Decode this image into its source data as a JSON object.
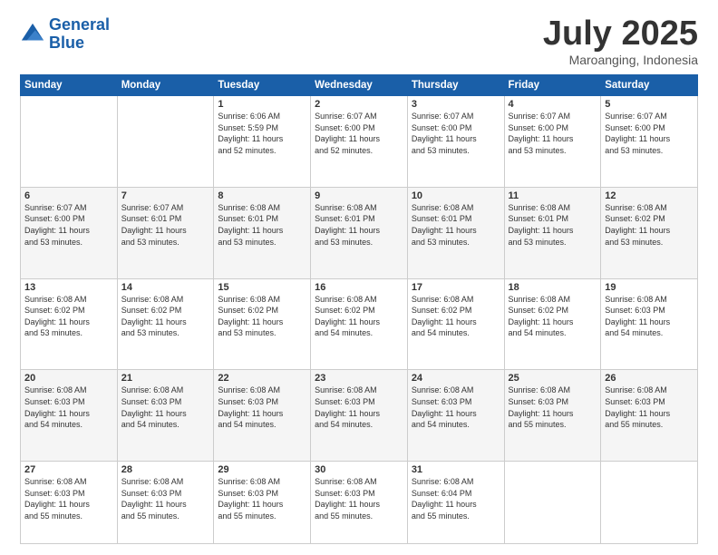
{
  "header": {
    "logo_line1": "General",
    "logo_line2": "Blue",
    "month": "July 2025",
    "location": "Maroanging, Indonesia"
  },
  "weekdays": [
    "Sunday",
    "Monday",
    "Tuesday",
    "Wednesday",
    "Thursday",
    "Friday",
    "Saturday"
  ],
  "weeks": [
    [
      {
        "day": "",
        "info": ""
      },
      {
        "day": "",
        "info": ""
      },
      {
        "day": "1",
        "info": "Sunrise: 6:06 AM\nSunset: 5:59 PM\nDaylight: 11 hours\nand 52 minutes."
      },
      {
        "day": "2",
        "info": "Sunrise: 6:07 AM\nSunset: 6:00 PM\nDaylight: 11 hours\nand 52 minutes."
      },
      {
        "day": "3",
        "info": "Sunrise: 6:07 AM\nSunset: 6:00 PM\nDaylight: 11 hours\nand 53 minutes."
      },
      {
        "day": "4",
        "info": "Sunrise: 6:07 AM\nSunset: 6:00 PM\nDaylight: 11 hours\nand 53 minutes."
      },
      {
        "day": "5",
        "info": "Sunrise: 6:07 AM\nSunset: 6:00 PM\nDaylight: 11 hours\nand 53 minutes."
      }
    ],
    [
      {
        "day": "6",
        "info": "Sunrise: 6:07 AM\nSunset: 6:00 PM\nDaylight: 11 hours\nand 53 minutes."
      },
      {
        "day": "7",
        "info": "Sunrise: 6:07 AM\nSunset: 6:01 PM\nDaylight: 11 hours\nand 53 minutes."
      },
      {
        "day": "8",
        "info": "Sunrise: 6:08 AM\nSunset: 6:01 PM\nDaylight: 11 hours\nand 53 minutes."
      },
      {
        "day": "9",
        "info": "Sunrise: 6:08 AM\nSunset: 6:01 PM\nDaylight: 11 hours\nand 53 minutes."
      },
      {
        "day": "10",
        "info": "Sunrise: 6:08 AM\nSunset: 6:01 PM\nDaylight: 11 hours\nand 53 minutes."
      },
      {
        "day": "11",
        "info": "Sunrise: 6:08 AM\nSunset: 6:01 PM\nDaylight: 11 hours\nand 53 minutes."
      },
      {
        "day": "12",
        "info": "Sunrise: 6:08 AM\nSunset: 6:02 PM\nDaylight: 11 hours\nand 53 minutes."
      }
    ],
    [
      {
        "day": "13",
        "info": "Sunrise: 6:08 AM\nSunset: 6:02 PM\nDaylight: 11 hours\nand 53 minutes."
      },
      {
        "day": "14",
        "info": "Sunrise: 6:08 AM\nSunset: 6:02 PM\nDaylight: 11 hours\nand 53 minutes."
      },
      {
        "day": "15",
        "info": "Sunrise: 6:08 AM\nSunset: 6:02 PM\nDaylight: 11 hours\nand 53 minutes."
      },
      {
        "day": "16",
        "info": "Sunrise: 6:08 AM\nSunset: 6:02 PM\nDaylight: 11 hours\nand 54 minutes."
      },
      {
        "day": "17",
        "info": "Sunrise: 6:08 AM\nSunset: 6:02 PM\nDaylight: 11 hours\nand 54 minutes."
      },
      {
        "day": "18",
        "info": "Sunrise: 6:08 AM\nSunset: 6:02 PM\nDaylight: 11 hours\nand 54 minutes."
      },
      {
        "day": "19",
        "info": "Sunrise: 6:08 AM\nSunset: 6:03 PM\nDaylight: 11 hours\nand 54 minutes."
      }
    ],
    [
      {
        "day": "20",
        "info": "Sunrise: 6:08 AM\nSunset: 6:03 PM\nDaylight: 11 hours\nand 54 minutes."
      },
      {
        "day": "21",
        "info": "Sunrise: 6:08 AM\nSunset: 6:03 PM\nDaylight: 11 hours\nand 54 minutes."
      },
      {
        "day": "22",
        "info": "Sunrise: 6:08 AM\nSunset: 6:03 PM\nDaylight: 11 hours\nand 54 minutes."
      },
      {
        "day": "23",
        "info": "Sunrise: 6:08 AM\nSunset: 6:03 PM\nDaylight: 11 hours\nand 54 minutes."
      },
      {
        "day": "24",
        "info": "Sunrise: 6:08 AM\nSunset: 6:03 PM\nDaylight: 11 hours\nand 54 minutes."
      },
      {
        "day": "25",
        "info": "Sunrise: 6:08 AM\nSunset: 6:03 PM\nDaylight: 11 hours\nand 55 minutes."
      },
      {
        "day": "26",
        "info": "Sunrise: 6:08 AM\nSunset: 6:03 PM\nDaylight: 11 hours\nand 55 minutes."
      }
    ],
    [
      {
        "day": "27",
        "info": "Sunrise: 6:08 AM\nSunset: 6:03 PM\nDaylight: 11 hours\nand 55 minutes."
      },
      {
        "day": "28",
        "info": "Sunrise: 6:08 AM\nSunset: 6:03 PM\nDaylight: 11 hours\nand 55 minutes."
      },
      {
        "day": "29",
        "info": "Sunrise: 6:08 AM\nSunset: 6:03 PM\nDaylight: 11 hours\nand 55 minutes."
      },
      {
        "day": "30",
        "info": "Sunrise: 6:08 AM\nSunset: 6:03 PM\nDaylight: 11 hours\nand 55 minutes."
      },
      {
        "day": "31",
        "info": "Sunrise: 6:08 AM\nSunset: 6:04 PM\nDaylight: 11 hours\nand 55 minutes."
      },
      {
        "day": "",
        "info": ""
      },
      {
        "day": "",
        "info": ""
      }
    ]
  ]
}
